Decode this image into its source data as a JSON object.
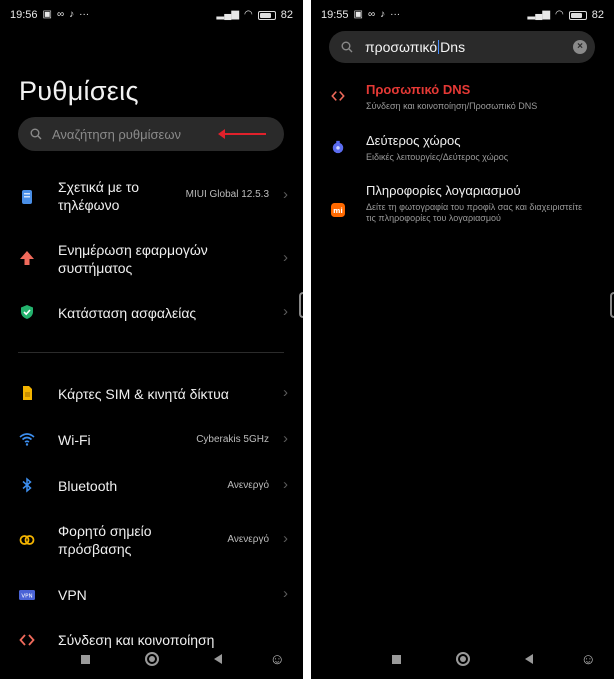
{
  "left": {
    "status": {
      "time": "19:56",
      "battery": "82",
      "battery_level": 0.82
    },
    "title": "Ρυθμίσεις",
    "search": {
      "placeholder": "Αναζήτηση ρυθμίσεων"
    },
    "items": [
      {
        "label": "Σχετικά με το\nτηλέφωνο",
        "value": "MIUI Global 12.5.3",
        "icon": "phone-info-icon"
      },
      {
        "label": "Ενημέρωση εφαρμογών\nσυστήματος",
        "value": "",
        "icon": "update-arrow-icon"
      },
      {
        "label": "Κατάσταση ασφαλείας",
        "value": "",
        "icon": "shield-icon"
      },
      {
        "label": "Κάρτες SIM & κινητά δίκτυα",
        "value": "",
        "icon": "sim-card-icon"
      },
      {
        "label": "Wi-Fi",
        "value": "Cyberakis 5GHz",
        "icon": "wifi-icon"
      },
      {
        "label": "Bluetooth",
        "value": "Ανενεργό",
        "icon": "bluetooth-icon"
      },
      {
        "label": "Φορητό σημείο\nπρόσβασης",
        "value": "Ανενεργό",
        "icon": "hotspot-icon"
      },
      {
        "label": "VPN",
        "value": "",
        "icon": "vpn-icon"
      },
      {
        "label": "Σύνδεση και κοινοποίηση",
        "value": "",
        "icon": "connection-sharing-icon"
      }
    ]
  },
  "right": {
    "status": {
      "time": "19:55",
      "battery": "82",
      "battery_level": 0.82
    },
    "search": {
      "query_before": "προσωπικό",
      "query_after": "Dns"
    },
    "results": [
      {
        "title": "Προσωπικό DNS",
        "path": "Σύνδεση και κοινοποίηση/Προσωπικό DNS",
        "icon": "connection-sharing-icon",
        "highlight": true
      },
      {
        "title": "Δεύτερος χώρος",
        "path": "Ειδικές λειτουργίες/Δεύτερος χώρος",
        "icon": "second-space-icon",
        "highlight": false
      },
      {
        "title": "Πληροφορίες λογαριασμού",
        "path": "Δείτε τη φωτογραφία του προφίλ σας και διαχειριστείτε τις πληροφορίες του λογαριασμού",
        "icon": "mi-account-icon",
        "highlight": false
      }
    ]
  },
  "colors": {
    "accent_red": "#e1212b",
    "result_highlight": "#e53935",
    "background": "#000000"
  }
}
